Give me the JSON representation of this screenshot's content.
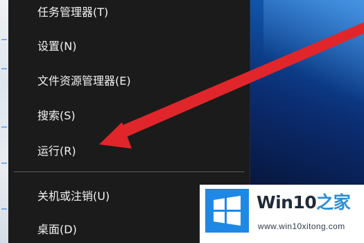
{
  "context_menu": {
    "items": [
      {
        "label": "任务管理器(T)"
      },
      {
        "label": "设置(N)"
      },
      {
        "label": "文件资源管理器(E)"
      },
      {
        "label": "搜索(S)"
      },
      {
        "label": "运行(R)"
      },
      {
        "label": "关机或注销(U)"
      },
      {
        "label": "桌面(D)"
      }
    ]
  },
  "watermark": {
    "brand_main": "Win10",
    "brand_accent": "之家",
    "url": "www.win10xitong.com"
  },
  "colors": {
    "menu_background": "#1b1b1b",
    "menu_text": "#f2f2f2",
    "divider": "#5a5a5a",
    "arrow": "#e0262a",
    "logo_blue": "#1e88e5",
    "brand_accent": "#2a8ed6"
  },
  "icons": {
    "logo": "windows-logo-icon",
    "arrow": "red-arrow-annotation"
  }
}
